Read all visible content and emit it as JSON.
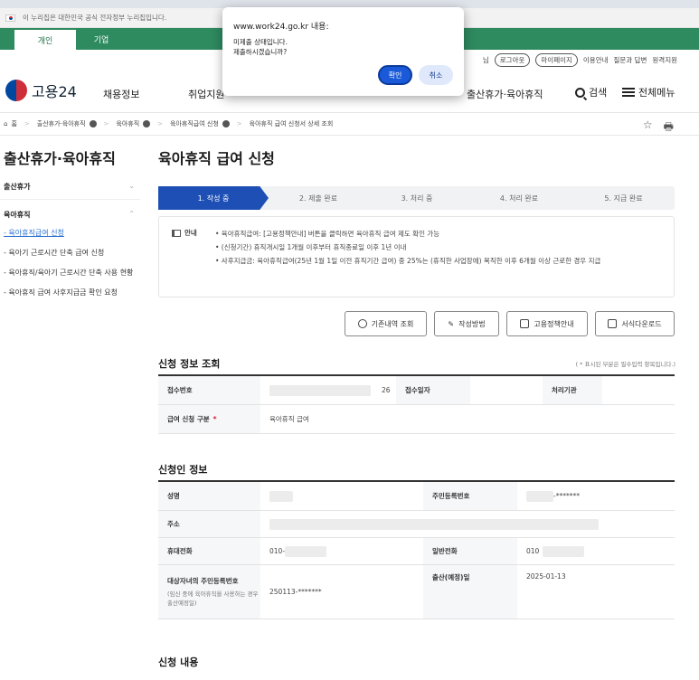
{
  "gov_banner": {
    "text": "이 누리집은 대한민국 공식 전자정부 누리집입니다."
  },
  "user_tabs": {
    "personal": "개인",
    "corporate": "기업"
  },
  "util_links": {
    "login": "로그아웃",
    "mypage": "마이페이지",
    "guide": "이용안내",
    "qna": "질문과 답변",
    "remote": "원격지원",
    "user_suffix": "님"
  },
  "header": {
    "logo_text": "고용24",
    "nav": [
      "채용정보",
      "취업지원",
      "출산휴가·육아휴직"
    ],
    "search": "검색",
    "all_menu": "전체메뉴"
  },
  "breadcrumb": [
    "홈",
    "출산휴가·육아휴직",
    "육아휴직",
    "육아휴직급여 신청",
    "육아휴직 급여 신청서 상세 조회"
  ],
  "sidebar": {
    "title": "출산휴가·육아휴직",
    "group1": "출산휴가",
    "group2": "육아휴직",
    "items": [
      "- 육아휴직급여 신청",
      "- 육아기 근로시간 단축 급여 신청",
      "- 육아휴직/육아기 근로시간 단축 사용 현황",
      "- 육아휴직 급여 사후지급금 확인 요청"
    ]
  },
  "main": {
    "title": "육아휴직 급여 신청",
    "steps": [
      "1. 작성 중",
      "2. 제출 완료",
      "3. 처리 중",
      "4. 처리 완료",
      "5. 지급 완료"
    ],
    "current_step": 1,
    "notice": {
      "label": "안내",
      "lines": [
        "• 육아휴직급여: [고용정책안내] 버튼을 클릭하면 육아휴직 급여 제도 확인 가능",
        "• (신청기간) 휴직개시일 1개월 이후부터 휴직종료일 이후 1년 이내",
        "• 사후지급금: 육아휴직급여(25년 1월 1일 이전 휴직기간 급여) 중 25%는 (휴직한 사업장에) 복직한 이후 6개월 이상 근로한 경우 지급"
      ]
    },
    "buttons": {
      "history": "기존내역 조회",
      "howto": "작성방법",
      "policy": "고용정책안내",
      "download": "서식다운로드"
    },
    "required_note": "( * 표시된 부분은 필수입력 항목입니다.)",
    "app_info": {
      "title": "신청 정보 조회",
      "receipt_no_label": "접수번호",
      "receipt_no_suffix": "26",
      "receipt_date_label": "접수일자",
      "process_label": "처리기관",
      "type_label": "급여 신청 구분",
      "type_value": "육아휴직 급여"
    },
    "applicant": {
      "title": "신청인 정보",
      "name_label": "성명",
      "rrn_label": "주민등록번호",
      "rrn_value": "-*******",
      "address_label": "주소",
      "mobile_label": "휴대전화",
      "mobile_value": "010-",
      "phone_label": "일반전화",
      "phone_value": "010",
      "child_rrn_label": "대상자녀의 주민등록번호",
      "child_rrn_sub": "(임신 중에 육아휴직을 사용하는 경우 출산예정일)",
      "child_rrn_value": "250113-*******",
      "birth_label": "출산(예정)일",
      "birth_value": "2025-01-13"
    },
    "content_title": "신청 내용"
  },
  "dialog": {
    "title": "www.work24.go.kr 내용:",
    "message_line1": "미제출 상태입니다.",
    "message_line2": "제출하시겠습니까?",
    "ok": "확인",
    "cancel": "취소"
  }
}
